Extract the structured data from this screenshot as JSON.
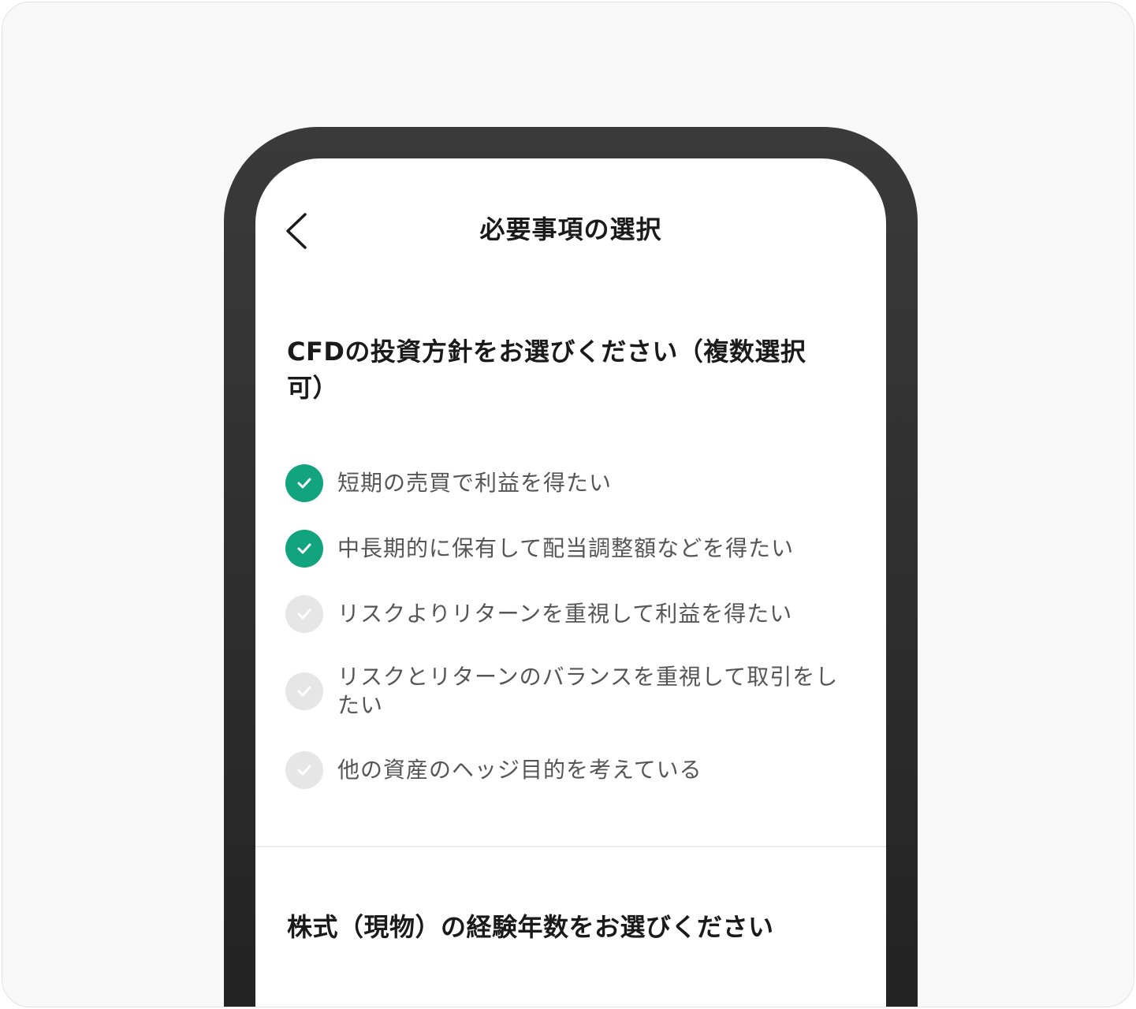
{
  "nav": {
    "title": "必要事項の選択"
  },
  "question1": {
    "title": "CFDの投資方針をお選びください（複数選択可）",
    "options": [
      {
        "label": "短期の売買で利益を得たい",
        "checked": true
      },
      {
        "label": "中長期的に保有して配当調整額などを得たい",
        "checked": true
      },
      {
        "label": "リスクよりリターンを重視して利益を得たい",
        "checked": false
      },
      {
        "label": "リスクとリターンのバランスを重視して取引をしたい",
        "checked": false
      },
      {
        "label": "他の資産のヘッジ目的を考えている",
        "checked": false
      }
    ]
  },
  "question2": {
    "title": "株式（現物）の経験年数をお選びください"
  },
  "colors": {
    "checked": "#12a37f",
    "unchecked": "#e6e6e6",
    "frame": "#2c2c2c"
  }
}
